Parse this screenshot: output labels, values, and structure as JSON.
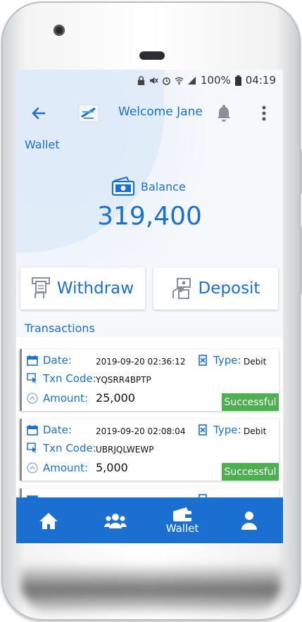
{
  "status_bar": {
    "battery": "100%",
    "time": "04:19"
  },
  "app_bar": {
    "welcome": "Welcome Jane"
  },
  "wallet": {
    "title": "Wallet",
    "balance_label": "Balance",
    "balance_value": "319,400"
  },
  "actions": {
    "withdraw": "Withdraw",
    "deposit": "Deposit"
  },
  "transactions": {
    "title": "Transactions",
    "labels": {
      "date": "Date:",
      "type": "Type:",
      "txn_code": "Txn Code:",
      "amount": "Amount:"
    },
    "items": [
      {
        "date": "2019-09-20 02:36:12",
        "type": "Debit",
        "txn_code": "YQSRR4BPTP",
        "amount": "25,000",
        "status": "Successful"
      },
      {
        "date": "2019-09-20 02:08:04",
        "type": "Debit",
        "txn_code": "UBRJQLWEWP",
        "amount": "5,000",
        "status": "Successful"
      }
    ]
  },
  "bottom_nav": {
    "wallet_label": "Wallet"
  },
  "colors": {
    "primary": "#1a6fd0",
    "success": "#4caf50"
  }
}
